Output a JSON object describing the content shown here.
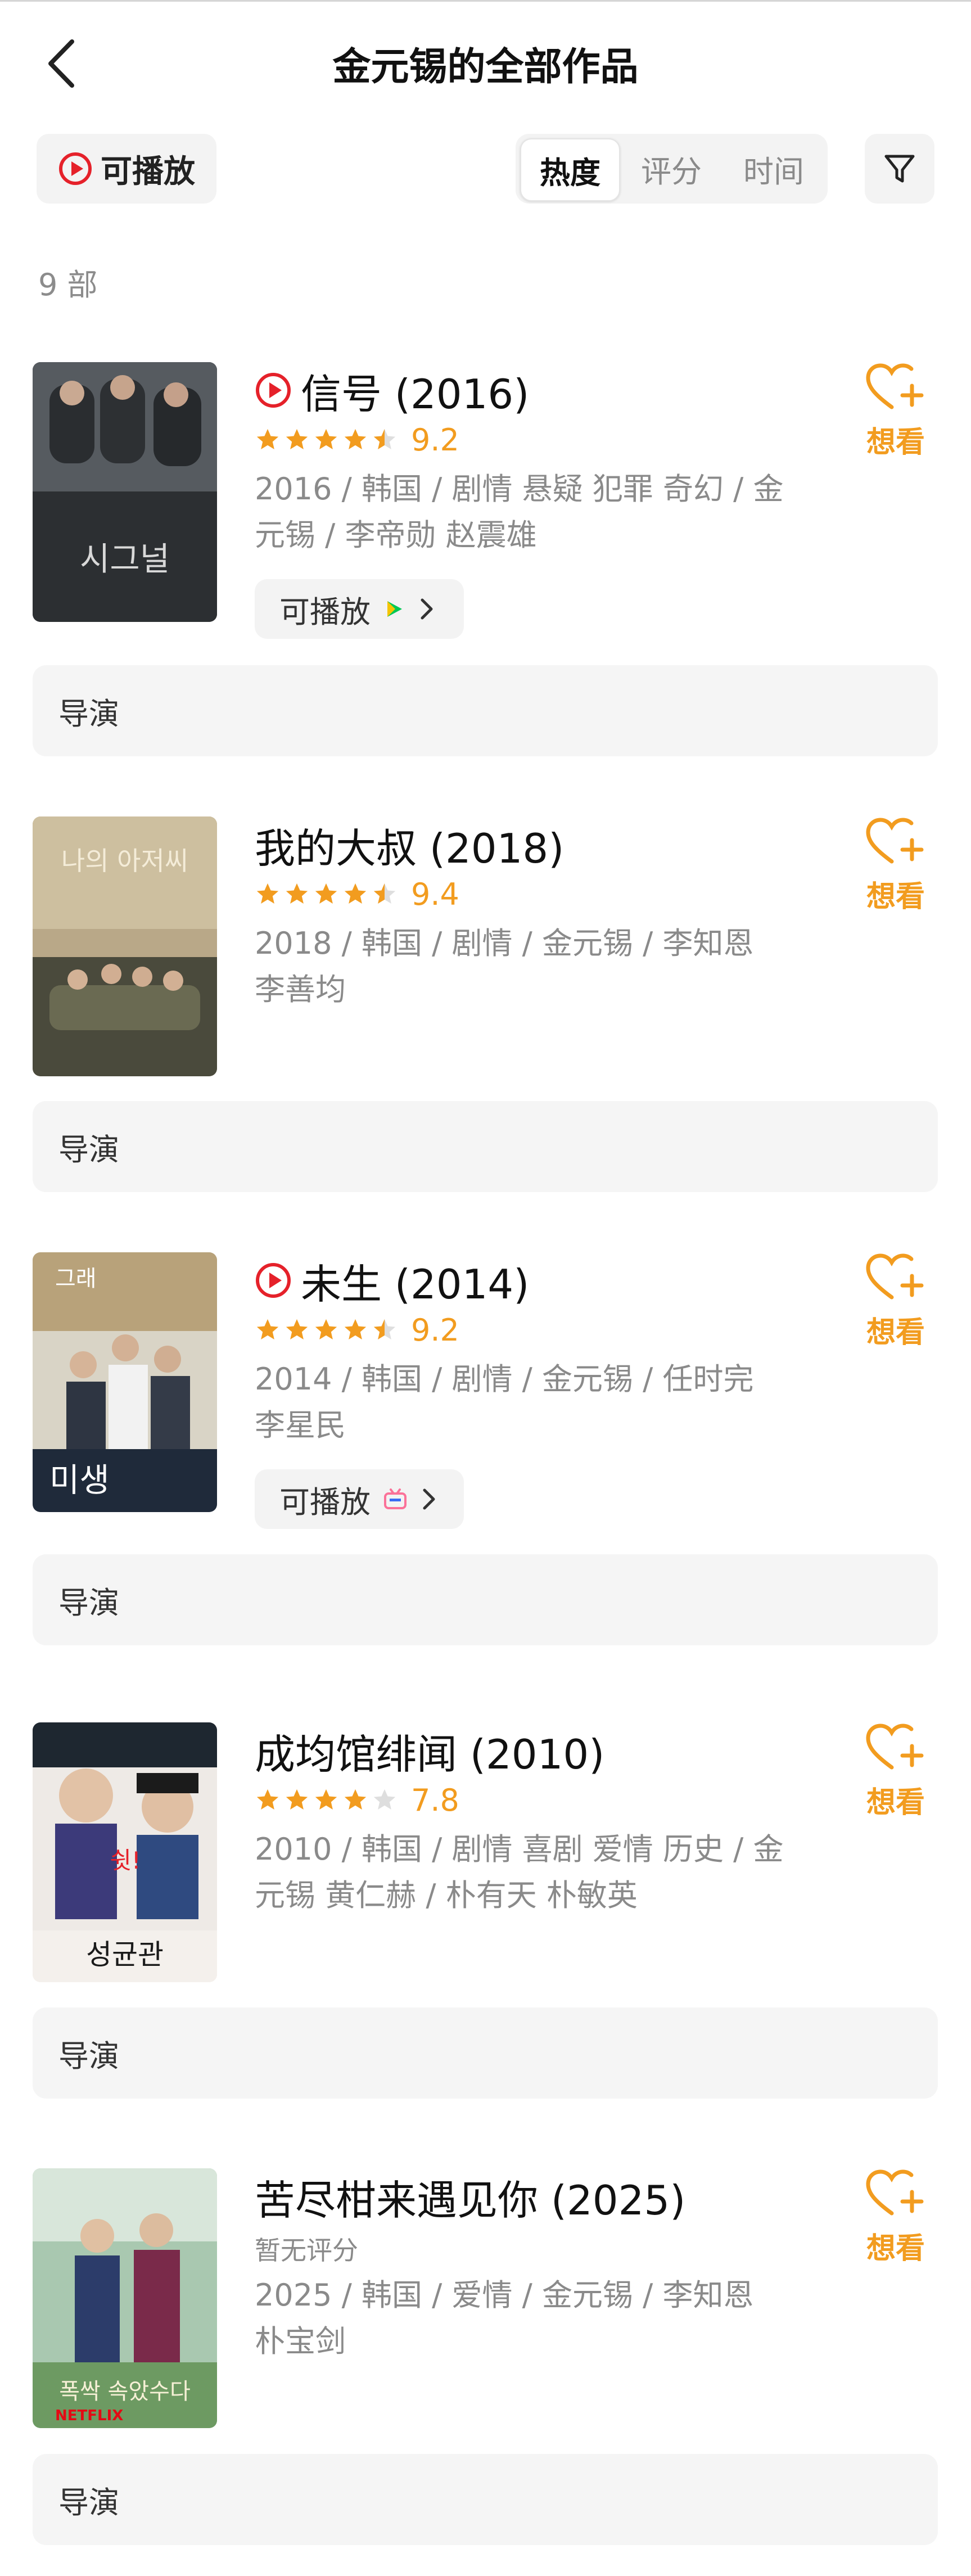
{
  "header": {
    "title": "金元锡的全部作品",
    "back_icon": "chevron-left-icon"
  },
  "filters": {
    "playable_label": "可播放",
    "sort_tabs": [
      "热度",
      "评分",
      "时间"
    ],
    "active_sort": "热度",
    "filter_icon": "funnel-icon"
  },
  "count_label": "9 部",
  "colors": {
    "accent": "#f29c1f",
    "play_red": "#e5212a",
    "muted": "#8a8a8a"
  },
  "works": [
    {
      "title": "信号 (2016)",
      "playable_badge": true,
      "stars": 4.5,
      "score": "9.2",
      "meta": "2016 / 韩国 / 剧情 悬疑 犯罪 奇幻 / 金元锡 / 李帝勋 赵震雄",
      "meta_line1": "2016 / 韩国 / 剧情 悬疑 犯罪 奇幻 / 金",
      "meta_line2": "元锡 / 李帝勋 赵震雄",
      "play_chip": "可播放",
      "play_platform_icon": "iqiyi-play-icon",
      "want_label": "想看",
      "director_label": "导演"
    },
    {
      "title": "我的大叔 (2018)",
      "playable_badge": false,
      "stars": 4.5,
      "score": "9.4",
      "meta_line1": "2018 / 韩国 / 剧情 / 金元锡 / 李知恩",
      "meta_line2": "李善均",
      "play_chip": null,
      "want_label": "想看",
      "director_label": "导演"
    },
    {
      "title": "未生 (2014)",
      "playable_badge": true,
      "stars": 4.5,
      "score": "9.2",
      "meta_line1": "2014 / 韩国 / 剧情 / 金元锡 / 任时完",
      "meta_line2": "李星民",
      "play_chip": "可播放",
      "play_platform_icon": "bilibili-tv-icon",
      "want_label": "想看",
      "director_label": "导演"
    },
    {
      "title": "成均馆绯闻 (2010)",
      "playable_badge": false,
      "stars": 4,
      "score": "7.8",
      "meta_line1": "2010 / 韩国 / 剧情 喜剧 爱情 历史 / 金",
      "meta_line2": "元锡 黄仁赫 / 朴有天 朴敏英",
      "play_chip": null,
      "want_label": "想看",
      "director_label": "导演"
    },
    {
      "title": "苦尽柑来遇见你 (2025)",
      "playable_badge": false,
      "stars": null,
      "score": null,
      "no_score_label": "暂无评分",
      "meta_line1": "2025 / 韩国 / 爱情 / 金元锡 / 李知恩",
      "meta_line2": "朴宝剑",
      "play_chip": null,
      "want_label": "想看",
      "director_label": "导演"
    }
  ]
}
